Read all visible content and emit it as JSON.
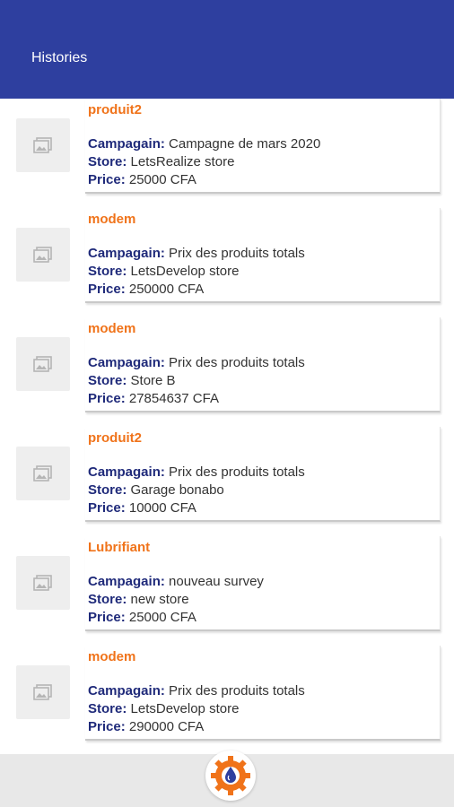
{
  "app": {
    "title": "Histories"
  },
  "labels": {
    "campaign": "Campagain:",
    "store": "Store:",
    "price": "Price:"
  },
  "icons": {
    "thumbnail": "image-placeholder-icon",
    "fab": "gear-droplet-logo-icon"
  },
  "colors": {
    "appbar": "#2e3f9f",
    "product_name": "#f0731a",
    "label": "#1f2a7a"
  },
  "histories": [
    {
      "product": "produit2",
      "campaign": "Campagne de mars 2020",
      "store": "LetsRealize store",
      "price": "25000 CFA"
    },
    {
      "product": "modem",
      "campaign": "Prix des produits totals",
      "store": "LetsDevelop store",
      "price": "250000 CFA"
    },
    {
      "product": "modem",
      "campaign": "Prix des produits totals",
      "store": "Store B",
      "price": "27854637 CFA"
    },
    {
      "product": "produit2",
      "campaign": "Prix des produits totals",
      "store": "Garage bonabo",
      "price": "10000 CFA"
    },
    {
      "product": "Lubrifiant",
      "campaign": "nouveau survey",
      "store": "new store",
      "price": "25000 CFA"
    },
    {
      "product": "modem",
      "campaign": "Prix des produits totals",
      "store": "LetsDevelop store",
      "price": "290000 CFA"
    }
  ]
}
